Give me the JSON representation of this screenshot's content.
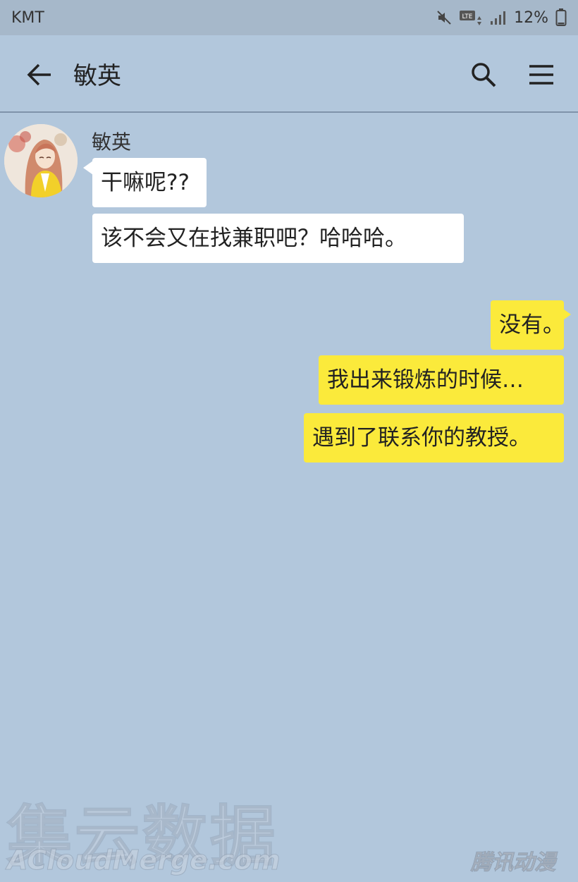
{
  "status_bar": {
    "carrier": "KMT",
    "network": "LTE",
    "battery": "12%",
    "icons": [
      "mute-icon",
      "lte-icon",
      "signal-icon",
      "battery-icon"
    ]
  },
  "header": {
    "title": "敏英",
    "icons": [
      "back-arrow-icon",
      "search-icon",
      "menu-icon"
    ]
  },
  "conversation": {
    "sender_name": "敏英",
    "incoming": [
      {
        "text": "干嘛呢??"
      },
      {
        "text": "该不会又在找兼职吧？哈哈哈。"
      }
    ],
    "outgoing": [
      {
        "text": "没有。"
      },
      {
        "text": "我出来锻炼的时候…"
      },
      {
        "text": "遇到了联系你的教授。"
      }
    ]
  },
  "watermarks": {
    "cn": "集云数据",
    "en": "ACloudMerge.com",
    "right": "腾讯动漫"
  },
  "colors": {
    "background": "#b2c7dc",
    "status_bar": "#a6b8ca",
    "incoming_bubble": "#ffffff",
    "outgoing_bubble": "#fbea3b"
  }
}
